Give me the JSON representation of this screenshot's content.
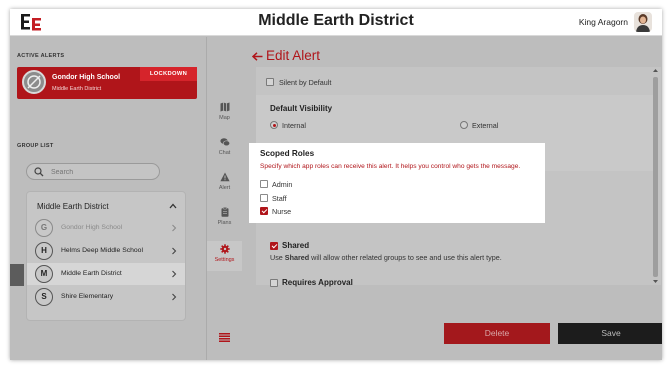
{
  "app": {
    "title": "Middle Earth District",
    "user_name": "King Aragorn"
  },
  "left": {
    "active_alerts_label": "ACTIVE ALERTS",
    "alert": {
      "school": "Gondor High School",
      "district": "Middle Earth District",
      "badge": "LOCKDOWN"
    },
    "group_list_label": "GROUP LIST",
    "search_placeholder": "Search",
    "group": {
      "name": "Middle Earth District",
      "items": [
        {
          "initial": "G",
          "name": "Gondor High School"
        },
        {
          "initial": "H",
          "name": "Helms Deep Middle School"
        },
        {
          "initial": "M",
          "name": "Middle Earth District"
        },
        {
          "initial": "S",
          "name": "Shire Elementary"
        }
      ]
    }
  },
  "nav": {
    "items": [
      {
        "label": "Map",
        "icon": "map-icon"
      },
      {
        "label": "Chat",
        "icon": "chat-icon"
      },
      {
        "label": "Alert",
        "icon": "alert-icon"
      },
      {
        "label": "Plans",
        "icon": "clipboard-icon"
      },
      {
        "label": "Settings",
        "icon": "gear-icon"
      }
    ],
    "active": "Settings"
  },
  "main": {
    "title": "Edit Alert",
    "silent_by_default": "Silent by Default",
    "default_visibility": {
      "label": "Default Visibility",
      "options": [
        "Internal",
        "External"
      ],
      "selected": "Internal"
    },
    "scoped_roles": {
      "label": "Scoped Roles",
      "description": "Specify which app roles can receive this alert. It helps you control who gets the message.",
      "roles": [
        {
          "name": "Admin",
          "checked": false
        },
        {
          "name": "Staff",
          "checked": false
        },
        {
          "name": "Nurse",
          "checked": true
        }
      ]
    },
    "shared": {
      "label": "Shared",
      "description_prefix": "Use ",
      "description_bold": "Shared",
      "description_suffix": " will allow other related groups to see and use this alert type.",
      "checked": true
    },
    "requires_approval": {
      "label": "Requires Approval",
      "checked": false
    },
    "delete_label": "Delete",
    "save_label": "Save"
  },
  "colors": {
    "accent": "#b0151a",
    "overlay": "#bdbdbd",
    "save_button": "#1c1c1c"
  }
}
